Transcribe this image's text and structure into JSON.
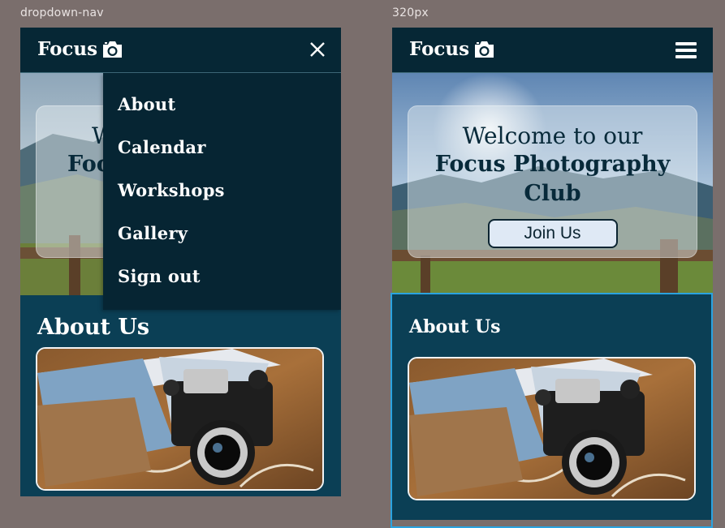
{
  "frames": {
    "left_label": "dropdown-nav",
    "right_label": "320px"
  },
  "brand": {
    "name": "Focus",
    "icon": "camera-icon"
  },
  "nav": {
    "close_icon": "close-icon",
    "menu_icon": "hamburger-menu-icon",
    "items": [
      "About",
      "Calendar",
      "Workshops",
      "Gallery",
      "Sign out"
    ]
  },
  "hero": {
    "line1": "Welcome to our",
    "line2a": "Focus Photography",
    "line2b": "Club",
    "left_partial1": "W",
    "left_partial2": "Foc",
    "cta": "Join Us"
  },
  "about": {
    "title": "About Us"
  },
  "colors": {
    "navbar": "#062735",
    "section": "#0b3f55",
    "selection": "#2aa3e0",
    "background": "#7a6e6c"
  }
}
